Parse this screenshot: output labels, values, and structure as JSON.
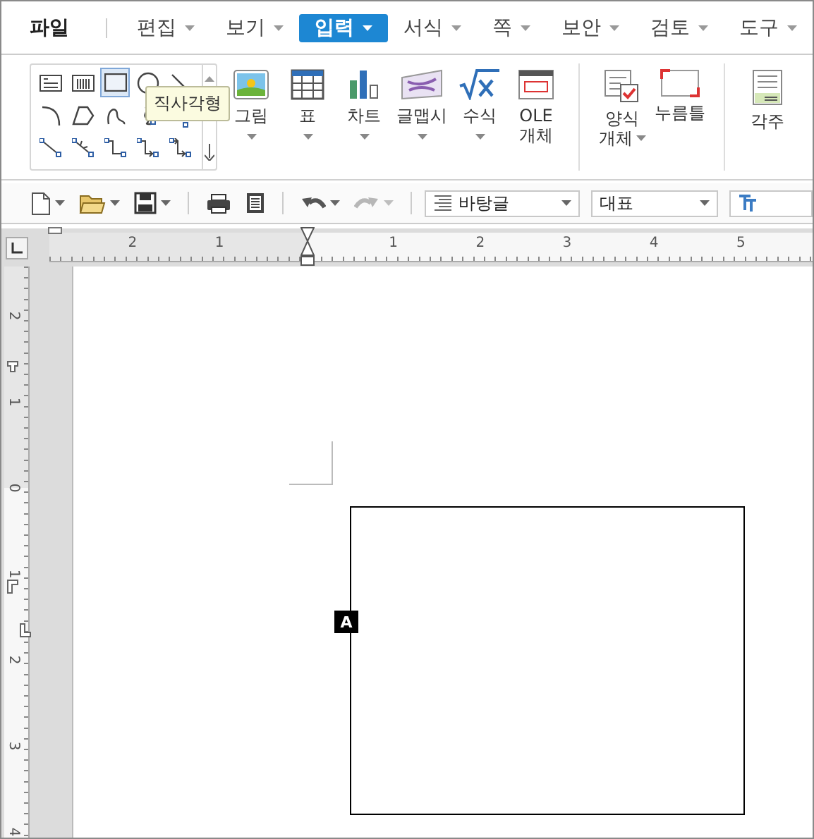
{
  "menu": [
    {
      "label": "파일",
      "kind": "file",
      "caret": false,
      "selected": false
    },
    {
      "label": "편집",
      "kind": "menu",
      "caret": true,
      "selected": false
    },
    {
      "label": "보기",
      "kind": "menu",
      "caret": true,
      "selected": false
    },
    {
      "label": "입력",
      "kind": "menu",
      "caret": true,
      "selected": true
    },
    {
      "label": "서식",
      "kind": "menu",
      "caret": true,
      "selected": false
    },
    {
      "label": "쪽",
      "kind": "menu",
      "caret": true,
      "selected": false
    },
    {
      "label": "보안",
      "kind": "menu",
      "caret": true,
      "selected": false
    },
    {
      "label": "검토",
      "kind": "menu",
      "caret": true,
      "selected": false
    },
    {
      "label": "도구",
      "kind": "menu",
      "caret": true,
      "selected": false
    }
  ],
  "ribbon": {
    "shapes": [
      {
        "kind": "text-box",
        "selected": false
      },
      {
        "kind": "vertical-box",
        "selected": false
      },
      {
        "kind": "rectangle",
        "selected": true
      },
      {
        "kind": "ellipse",
        "selected": false
      },
      {
        "kind": "line",
        "selected": false
      },
      {
        "kind": "arc",
        "selected": false
      },
      {
        "kind": "polygon",
        "selected": false
      },
      {
        "kind": "curve",
        "selected": false
      },
      {
        "kind": "freeform",
        "selected": false
      },
      {
        "kind": "handle",
        "selected": false
      },
      {
        "kind": "connector-straight",
        "selected": false
      },
      {
        "kind": "connector-arrow",
        "selected": false
      },
      {
        "kind": "connector-elbow",
        "selected": false
      },
      {
        "kind": "connector-elbow-arrow",
        "selected": false
      },
      {
        "kind": "connector-elbow-double",
        "selected": false
      }
    ],
    "tooltip": "직사각형",
    "groups": [
      [
        {
          "kind": "picture",
          "lines": [
            "그림"
          ],
          "caret": true
        },
        {
          "kind": "table",
          "lines": [
            "표"
          ],
          "caret": true
        },
        {
          "kind": "chart",
          "lines": [
            "차트"
          ],
          "caret": true
        },
        {
          "kind": "textart",
          "lines": [
            "글맵시"
          ],
          "caret": true
        },
        {
          "kind": "equation",
          "lines": [
            "수식"
          ],
          "caret": true
        },
        {
          "kind": "ole",
          "lines": [
            "OLE",
            "개체"
          ]
        }
      ],
      [
        {
          "kind": "form",
          "lines": [
            "양식",
            "개체"
          ],
          "caret": true
        },
        {
          "kind": "field",
          "lines": [
            "누름틀"
          ]
        }
      ],
      [
        {
          "kind": "footnote",
          "lines": [
            "각주"
          ]
        }
      ]
    ]
  },
  "toolbar": {
    "buttons": [
      {
        "kind": "new",
        "dropdown": true,
        "disabled": false
      },
      {
        "kind": "open",
        "dropdown": true,
        "disabled": false
      },
      {
        "kind": "save",
        "dropdown": true,
        "disabled": false
      },
      {
        "kind": "print",
        "dropdown": false,
        "disabled": false
      },
      {
        "kind": "preview",
        "dropdown": false,
        "disabled": false
      },
      {
        "kind": "undo",
        "dropdown": true,
        "disabled": false
      },
      {
        "kind": "redo",
        "dropdown": true,
        "disabled": true
      }
    ],
    "style": "바탕글",
    "font": "대표"
  },
  "ruler": {
    "horizontal": [
      "2",
      "1",
      "1",
      "2",
      "3",
      "4",
      "5"
    ],
    "vertical": [
      "2",
      "1",
      "0",
      "1",
      "2",
      "3",
      "4"
    ]
  },
  "document": {
    "anchor": "A"
  }
}
